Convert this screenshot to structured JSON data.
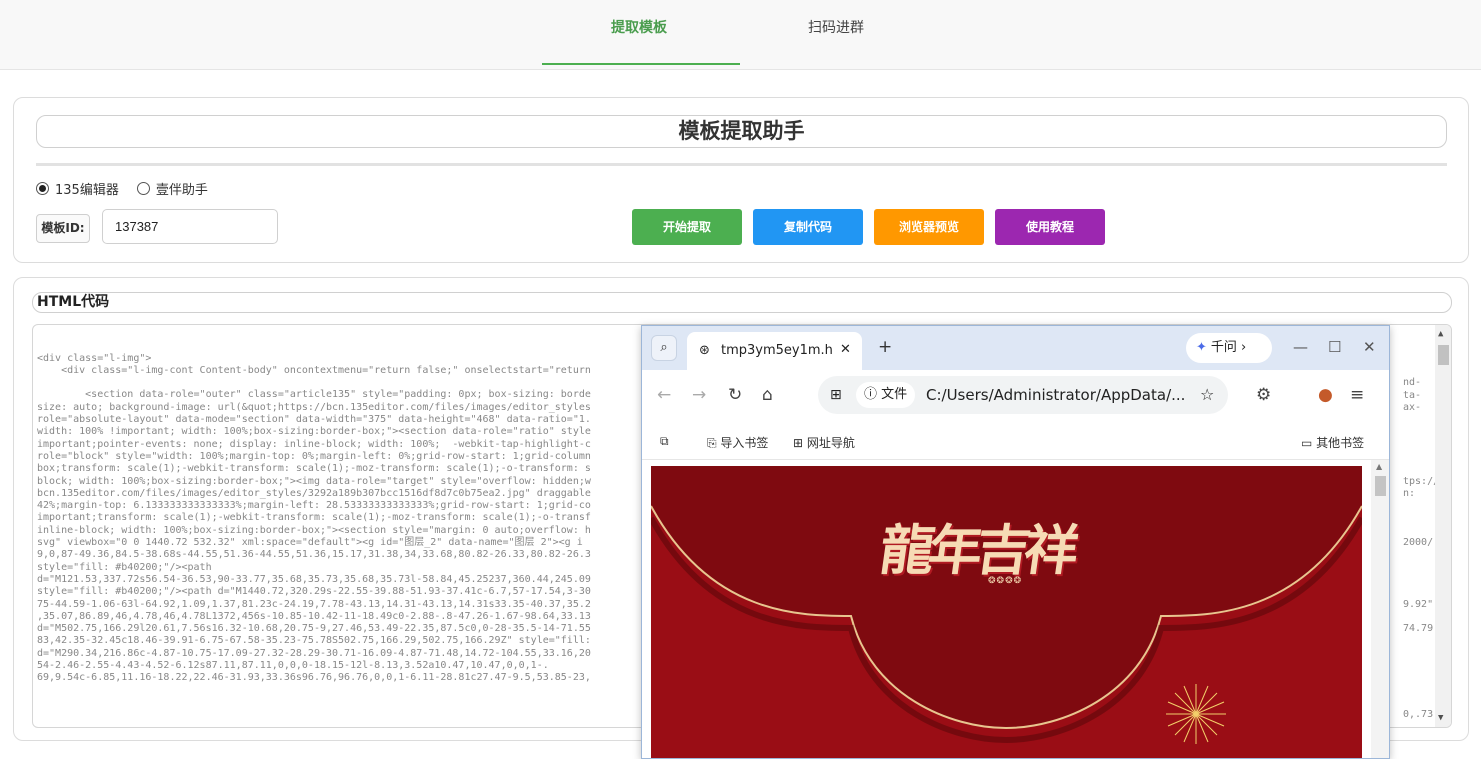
{
  "topnav": {
    "tabs": [
      {
        "label": "提取模板",
        "active": true
      },
      {
        "label": "扫码进群",
        "active": false
      }
    ]
  },
  "extractor": {
    "title": "模板提取助手",
    "radios": [
      {
        "label": "135编辑器",
        "checked": true
      },
      {
        "label": "壹伴助手",
        "checked": false
      }
    ],
    "id_label": "模板ID:",
    "id_value": "137387",
    "buttons": [
      {
        "label": "开始提取",
        "color": "#4caf50"
      },
      {
        "label": "复制代码",
        "color": "#2196f3"
      },
      {
        "label": "浏览器预览",
        "color": "#ff9800"
      },
      {
        "label": "使用教程",
        "color": "#9c27b0"
      }
    ]
  },
  "code": {
    "label": "HTML代码",
    "lines": [
      "<div class=\"l-img\">",
      "    <div class=\"l-img-cont Content-body\" oncontextmenu=\"return false;\" onselectstart=\"return",
      "",
      "        <section data-role=\"outer\" class=\"article135\" style=\"padding: 0px; box-sizing: borde",
      "size: auto; background-image: url(&quot;https://bcn.135editor.com/files/images/editor_styles",
      "role=\"absolute-layout\" data-mode=\"section\" data-width=\"375\" data-height=\"468\" data-ratio=\"1.",
      "width: 100% !important; width: 100%;box-sizing:border-box;\"><section data-role=\"ratio\" style",
      "important;pointer-events: none; display: inline-block; width: 100%;  -webkit-tap-highlight-c",
      "role=\"block\" style=\"width: 100%;margin-top: 0%;margin-left: 0%;grid-row-start: 1;grid-column",
      "box;transform: scale(1);-webkit-transform: scale(1);-moz-transform: scale(1);-o-transform: s",
      "block; width: 100%;box-sizing:border-box;\"><img data-role=\"target\" style=\"overflow: hidden;w",
      "bcn.135editor.com/files/images/editor_styles/3292a189b307bcc1516df8d7c0b75ea2.jpg\" draggable",
      "42%;margin-top: 6.133333333333333%;margin-left: 28.53333333333333%;grid-row-start: 1;grid-co",
      "important;transform: scale(1);-webkit-transform: scale(1);-moz-transform: scale(1);-o-transf",
      "inline-block; width: 100%;box-sizing:border-box;\"><section style=\"margin: 0 auto;overflow: h",
      "svg\" viewbox=\"0 0 1440.72 532.32\" xml:space=\"default\"><g id=\"图层_2\" data-name=\"图层 2\"><g i",
      "9,0,87-49.36,84.5-38.68s-44.55,51.36-44.55,51.36,15.17,31.38,34,33.68,80.82-26.33,80.82-26.3",
      "style=\"fill: #b40200;\"/><path",
      "d=\"M121.53,337.72s56.54-36.53,90-33.77,35.68,35.73,35.68,35.73l-58.84,45.25237,360.44,245.09",
      "style=\"fill: #b40200;\"/><path d=\"M1440.72,320.29s-22.55-39.88-51.93-37.41c-6.7,57-17.54,3-30",
      "75-44.59-1.06-63l-64.92,1.09,1.37,81.23c-24.19,7.78-43.13,14.31-43.13,14.31s33.35-40.37,35.2",
      ",35.07,86.89,46,4.78,46,4.78L1372,456s-10.85-10.42-11-18.49c0-2.88-.8-47.26-1.67-98.64,33.13",
      "d=\"M502.75,166.29l20.61,7.56s16.32-10.68,20.75-9,27.46,53.49-22.35,87.5c0,0-28-35.5-14-71.55",
      "83,42.35-32.45c18.46-39.91-6.75-67.58-35.23-75.78S502.75,166.29,502.75,166.29Z\" style=\"fill:",
      "d=\"M290.34,216.86c-4.87-10.75-17.09-27.32-28.29-30.71-16.09-4.87-71.48,14.72-104.55,33.16,20",
      "54-2.46-2.55-4.43-4.52-6.12s87.11,87.11,0,0,0-18.15-12l-8.13,3.52a10.47,10.47,0,0,1-.",
      "69,9.54c-6.85,11.16-18.22,22.46-31.93,33.36s96.76,96.76,0,0,1-6.11-28.81c27.47-9.5,53.85-23,"
    ],
    "right_fragments": [
      {
        "row": 4,
        "text": "nd-"
      },
      {
        "row": 5,
        "text": "ta-"
      },
      {
        "row": 6,
        "text": "ax-"
      },
      {
        "row": 12,
        "text": "tps://"
      },
      {
        "row": 13,
        "text": "n:"
      },
      {
        "row": 17,
        "text": "2000/"
      },
      {
        "row": 22,
        "text": "9.92\""
      },
      {
        "row": 24,
        "text": "74.79"
      },
      {
        "row": 31,
        "text": "0,.73"
      }
    ]
  },
  "browser": {
    "tab_title": "tmp3ym5ey1m.h",
    "qianwen_label": "千问 ›",
    "file_badge": "ⓘ 文件",
    "url": "C:/Users/Administrator/AppData/...",
    "bookmarks": [
      "导入书签",
      "网址导航"
    ],
    "other_bookmarks": "其他书签",
    "page_calligraphy": "龍年吉祥"
  }
}
